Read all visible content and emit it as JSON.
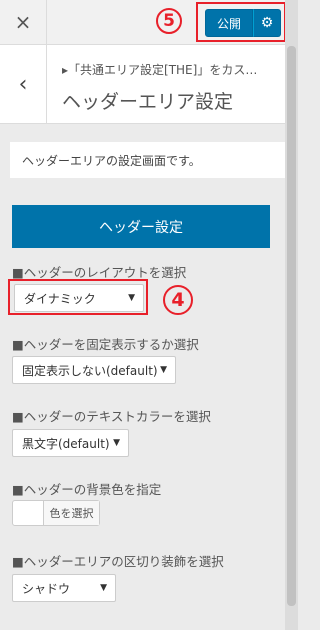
{
  "topbar": {
    "close_icon": "×",
    "publish_label": "公開",
    "gear_icon": "⚙",
    "annotation_5": "5"
  },
  "panel": {
    "back_icon": "‹",
    "breadcrumb": "▸「共通エリア設定[THE]」をカス…",
    "title": "ヘッダーエリア設定",
    "description": "ヘッダーエリアの設定画面です。",
    "section_button": "ヘッダー設定"
  },
  "fields": {
    "layout": {
      "label": "■ヘッダーのレイアウトを選択",
      "value": "ダイナミック",
      "annotation_4": "4"
    },
    "fixed": {
      "label": "■ヘッダーを固定表示するか選択",
      "value": "固定表示しない(default)"
    },
    "text_color": {
      "label": "■ヘッダーのテキストカラーを選択",
      "value": "黒文字(default)"
    },
    "bg_color": {
      "label": "■ヘッダーの背景色を指定",
      "button": "色を選択"
    },
    "divider": {
      "label": "■ヘッダーエリアの区切り装飾を選択",
      "value": "シャドウ"
    }
  },
  "caret": "▼",
  "colors": {
    "accent": "#0073aa",
    "annotation": "#e8202a"
  }
}
